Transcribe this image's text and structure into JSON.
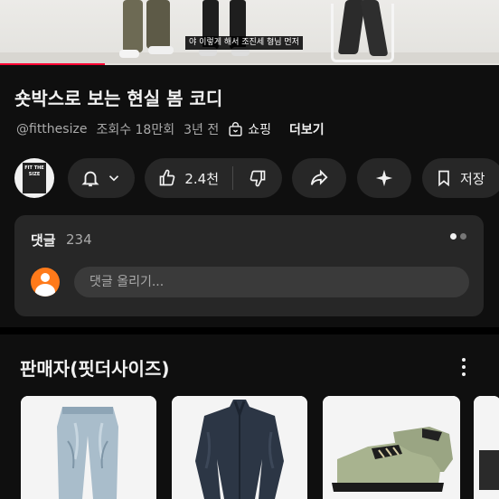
{
  "video": {
    "subtitle": "야 이렇게 해서 조진세 형님 먼저",
    "progress": 0.21,
    "accent_color": "#ff0033"
  },
  "title": "숏박스로 보는 현실 봄 코디",
  "meta": {
    "channel_handle": "@fitthesize",
    "views": "조회수 18만회",
    "age": "3년 전",
    "shopping_label": "쇼핑",
    "more_label": "더보기"
  },
  "channel": {
    "avatar_text": "FIT THE SIZE"
  },
  "actions": {
    "bell_icon": "bell-icon",
    "likes": "2.4천",
    "share_icon": "share-icon",
    "ai_icon": "sparkle-icon",
    "save_label": "저장"
  },
  "comments": {
    "title": "댓글",
    "count": "234",
    "placeholder": "댓글 올리기..."
  },
  "seller": {
    "title": "판매자(핏더사이즈)",
    "products": [
      {
        "name": "jeans",
        "kind": "light-wash-denim"
      },
      {
        "name": "shirt",
        "kind": "dark-navy-shirt"
      },
      {
        "name": "shoes",
        "kind": "olive-suede-shoes"
      },
      {
        "name": "partial",
        "kind": "dark-item"
      }
    ]
  }
}
